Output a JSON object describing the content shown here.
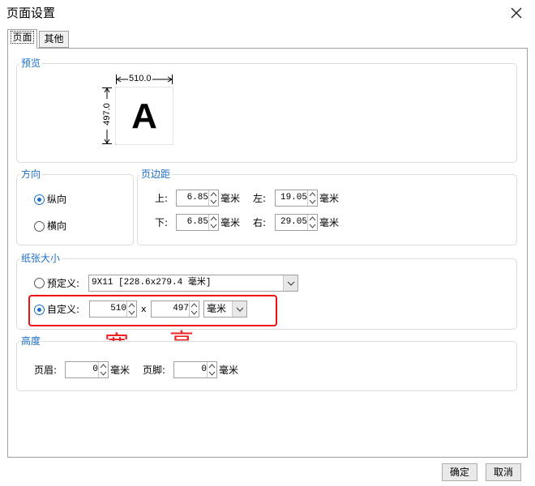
{
  "window": {
    "title": "页面设置",
    "close_icon": "close-icon"
  },
  "tabs": [
    {
      "label": "页面",
      "active": true
    },
    {
      "label": "其他",
      "active": false
    }
  ],
  "preview": {
    "title": "预览",
    "width_label": "510.0",
    "height_label": "497.0",
    "letter": "A"
  },
  "orientation": {
    "title": "方向",
    "portrait": {
      "label": "纵向",
      "checked": true
    },
    "landscape": {
      "label": "横向",
      "checked": false
    }
  },
  "margins": {
    "title": "页边距",
    "top": {
      "label": "上:",
      "value": "6.85",
      "unit": "毫米"
    },
    "left": {
      "label": "左:",
      "value": "19.05",
      "unit": "毫米"
    },
    "bottom": {
      "label": "下:",
      "value": "6.85",
      "unit": "毫米"
    },
    "right": {
      "label": "右:",
      "value": "29.05",
      "unit": "毫米"
    }
  },
  "paper_size": {
    "title": "纸张大小",
    "preset": {
      "label": "预定义:",
      "value": "9X11 [228.6x279.4 毫米]",
      "checked": false
    },
    "custom": {
      "label": "自定义:",
      "width": "510",
      "times": "x",
      "height": "497",
      "unit": "毫米",
      "checked": true
    }
  },
  "annotations": {
    "width_note": "宽",
    "height_note": "高"
  },
  "height_section": {
    "title": "高度",
    "header": {
      "label": "页眉:",
      "value": "0",
      "unit": "毫米"
    },
    "footer": {
      "label": "页脚:",
      "value": "0",
      "unit": "毫米"
    }
  },
  "buttons": {
    "ok": "确定",
    "cancel": "取消"
  },
  "colors": {
    "accent": "#1a6fc9",
    "highlight": "#ee1111"
  }
}
